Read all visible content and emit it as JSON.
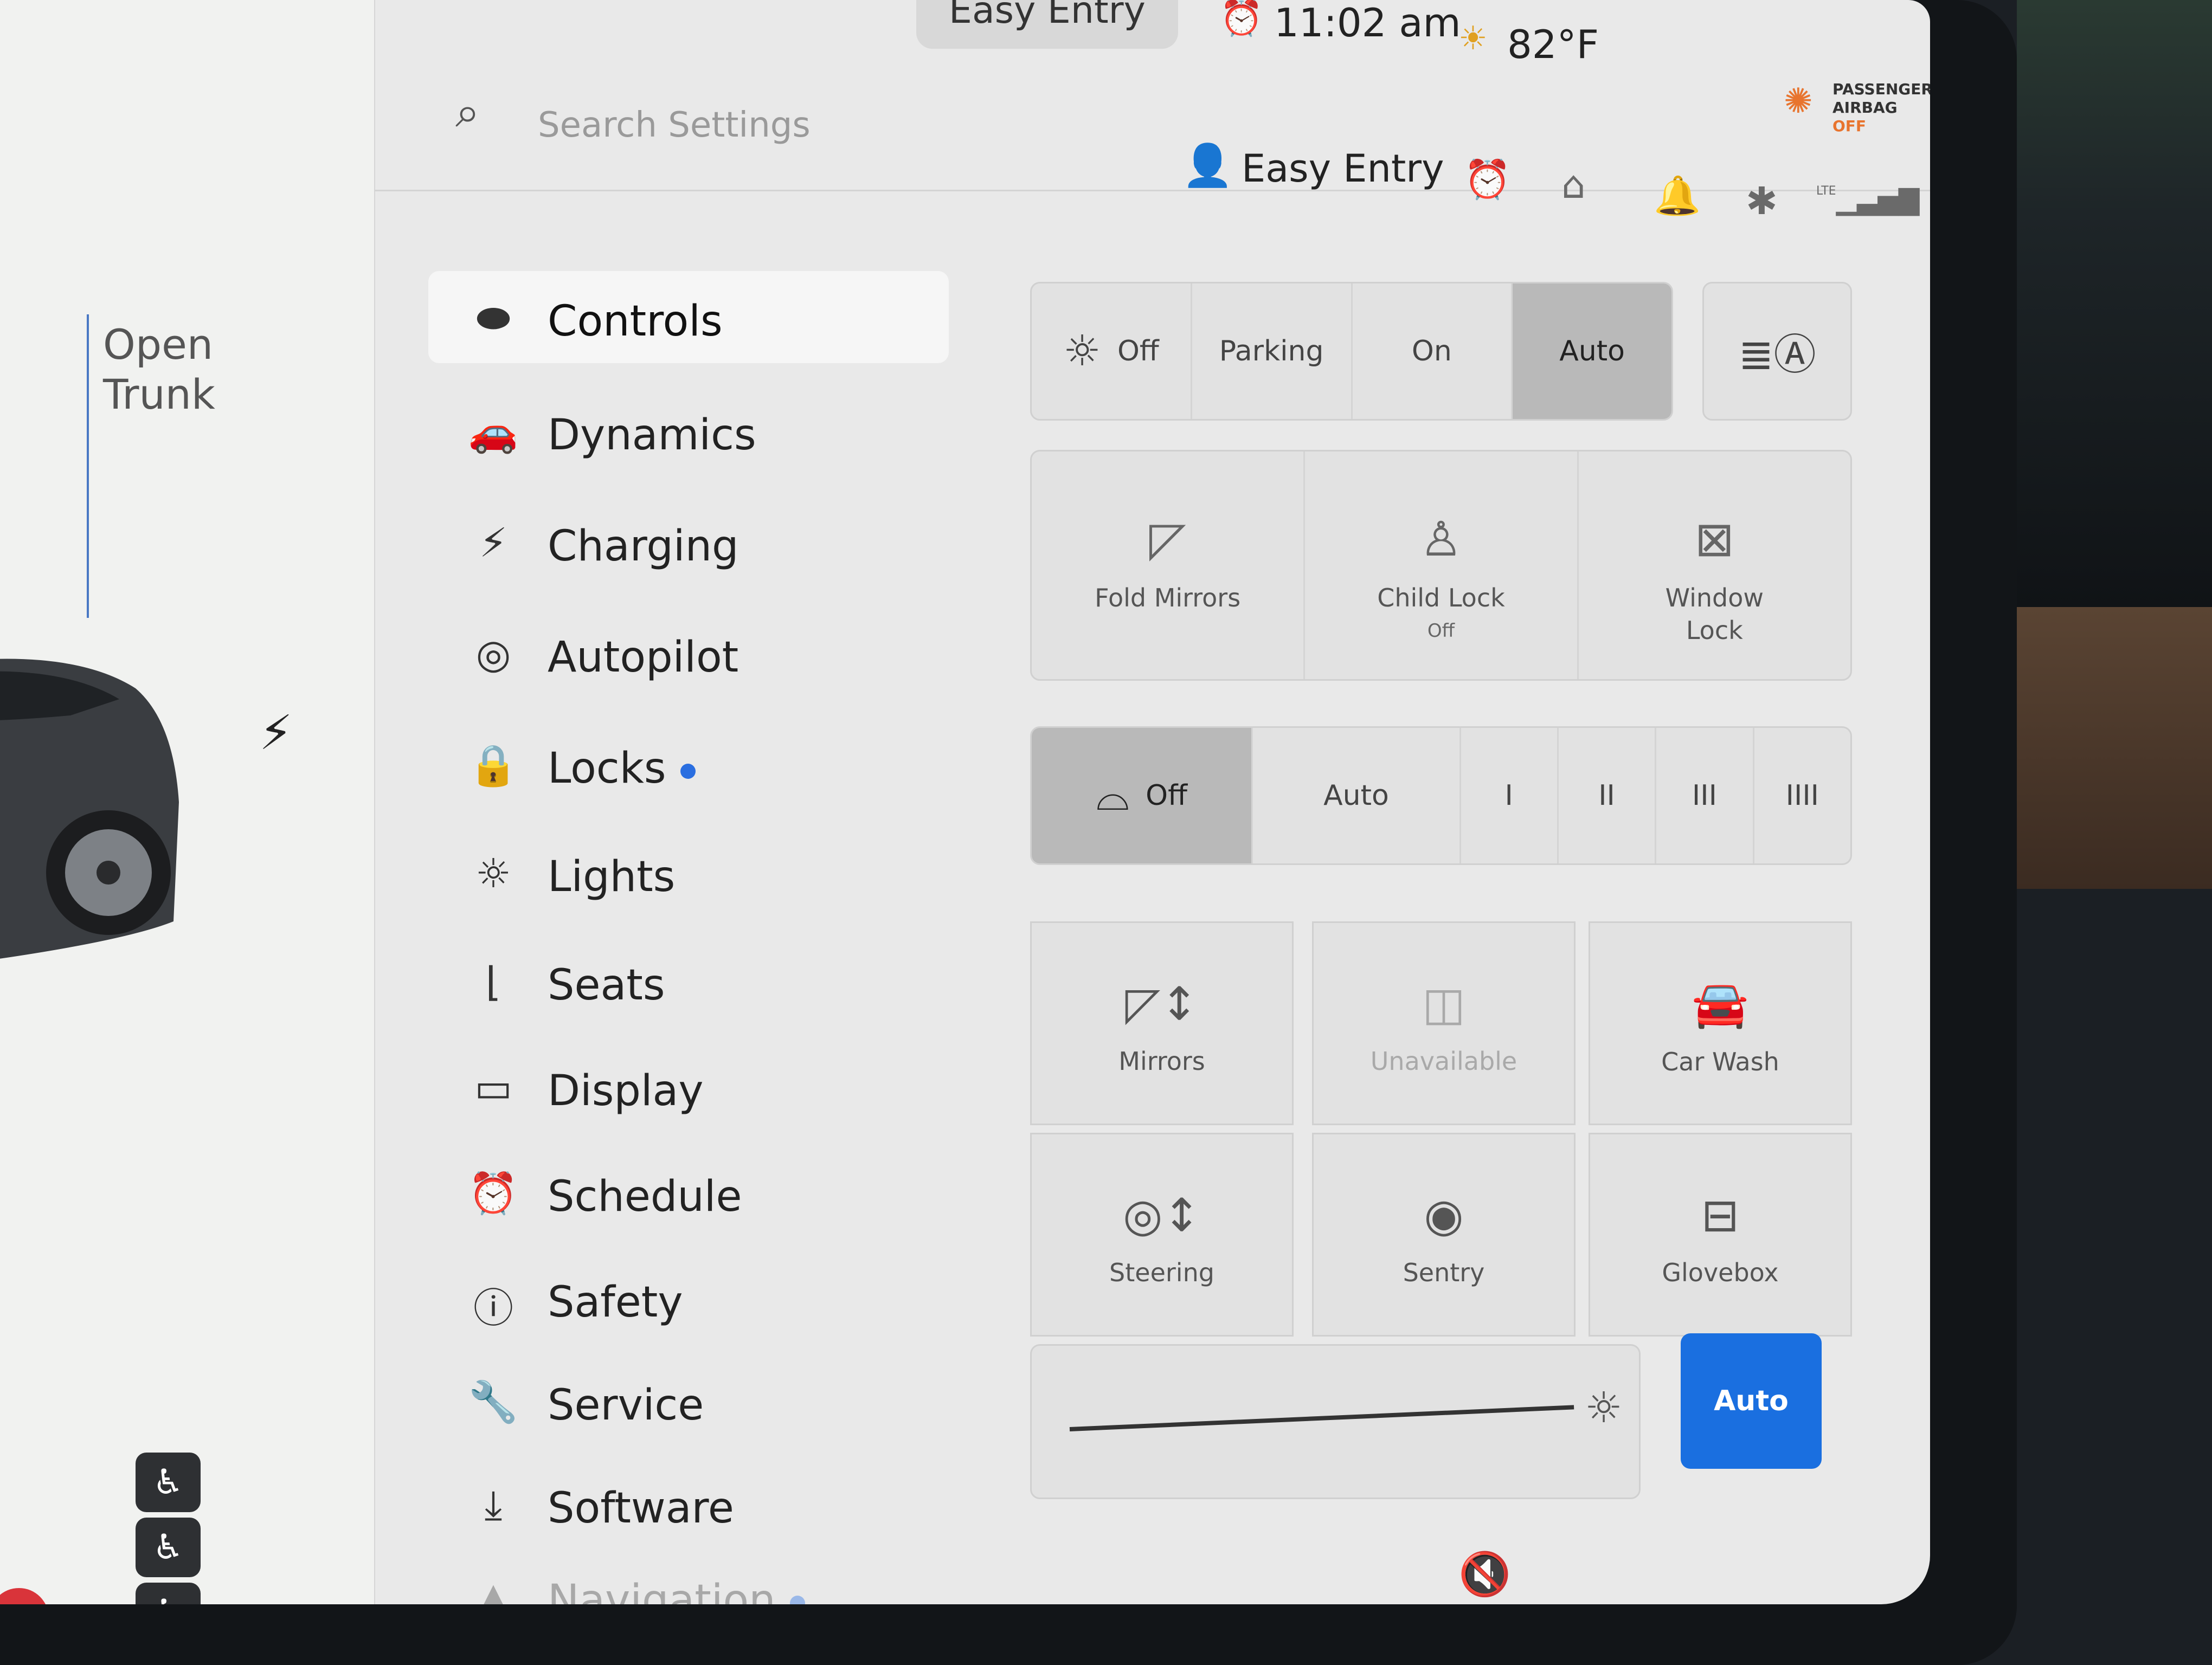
{
  "status": {
    "profile_tab": "Easy Entry",
    "time": "11:02 am",
    "temperature": "82°F",
    "airbag_line1": "PASSENGER",
    "airbag_line2": "AIRBAG",
    "airbag_state": "OFF",
    "lte_label": "LTE"
  },
  "car_panel": {
    "open_trunk_line1": "Open",
    "open_trunk_line2": "Trunk"
  },
  "search": {
    "placeholder": "Search Settings"
  },
  "header": {
    "profile_name": "Easy Entry"
  },
  "menu": {
    "items": [
      {
        "label": "Controls",
        "icon": "toggle-icon",
        "glyph": "⬬"
      },
      {
        "label": "Dynamics",
        "icon": "car-icon",
        "glyph": "🚗"
      },
      {
        "label": "Charging",
        "icon": "lightning-icon",
        "glyph": "⚡"
      },
      {
        "label": "Autopilot",
        "icon": "steering-wheel-icon",
        "glyph": "◎"
      },
      {
        "label": "Locks",
        "icon": "lock-icon",
        "glyph": "🔒"
      },
      {
        "label": "Lights",
        "icon": "bulb-icon",
        "glyph": "☼"
      },
      {
        "label": "Seats",
        "icon": "seat-icon",
        "glyph": "⌊"
      },
      {
        "label": "Display",
        "icon": "display-icon",
        "glyph": "▭"
      },
      {
        "label": "Schedule",
        "icon": "schedule-icon",
        "glyph": "⏰"
      },
      {
        "label": "Safety",
        "icon": "safety-icon",
        "glyph": "ⓘ"
      },
      {
        "label": "Service",
        "icon": "wrench-icon",
        "glyph": "🔧"
      },
      {
        "label": "Software",
        "icon": "download-icon",
        "glyph": "⤓"
      },
      {
        "label": "Navigation",
        "icon": "navigation-icon",
        "glyph": "▲"
      }
    ]
  },
  "headlights": {
    "options": [
      "Off",
      "Parking",
      "On",
      "Auto"
    ],
    "selected": "Auto"
  },
  "access_tiles": {
    "fold_mirrors": "Fold Mirrors",
    "child_lock": "Child Lock",
    "child_lock_state": "Off",
    "window_lock_line1": "Window",
    "window_lock_line2": "Lock"
  },
  "wipers": {
    "options": [
      "Off",
      "Auto",
      "I",
      "II",
      "III",
      "IIII"
    ],
    "selected": "Off"
  },
  "quick_tiles": {
    "mirrors": "Mirrors",
    "unavailable": "Unavailable",
    "car_wash": "Car Wash",
    "steering": "Steering",
    "sentry": "Sentry",
    "glovebox": "Glovebox"
  },
  "display_brightness": {
    "auto_label": "Auto",
    "level": 0.97
  },
  "colors": {
    "accent_blue": "#1a6fe0",
    "warning_orange": "#e8742e",
    "selected_gray": "#b9b9b9"
  }
}
